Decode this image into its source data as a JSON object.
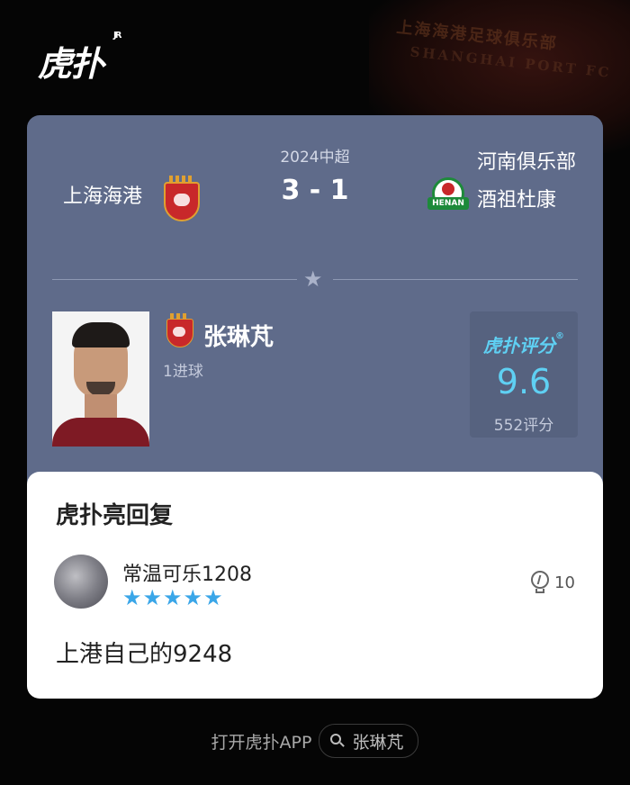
{
  "brand": {
    "logo_text": "虎扑",
    "logo_sup": "JR"
  },
  "background": {
    "crest_text": "上海海港足球俱乐部",
    "crest_sub": "SHANGHAI PORT FC"
  },
  "match": {
    "league": "2024中超",
    "home_team": "上海海港",
    "away_team": "河南俱乐部酒祖杜康",
    "score": "3 - 1",
    "away_badge_text": "HENAN"
  },
  "player": {
    "name": "张琳芃",
    "stat": "1进球"
  },
  "rating": {
    "brand": "虎扑评分",
    "reg_mark": "®",
    "value": "9.6",
    "count": "552评分"
  },
  "reply": {
    "title": "虎扑亮回复",
    "user": "常温可乐1208",
    "stars": "★★★★★",
    "star_count": 5,
    "likes": "10",
    "comment": "上港自己的9248"
  },
  "footer": {
    "open_app": "打开虎扑APP",
    "search_term": "张琳芃"
  },
  "colors": {
    "card_bg": "#5f6b8a",
    "accent": "#5fd0f3",
    "star": "#3aa6e8"
  }
}
